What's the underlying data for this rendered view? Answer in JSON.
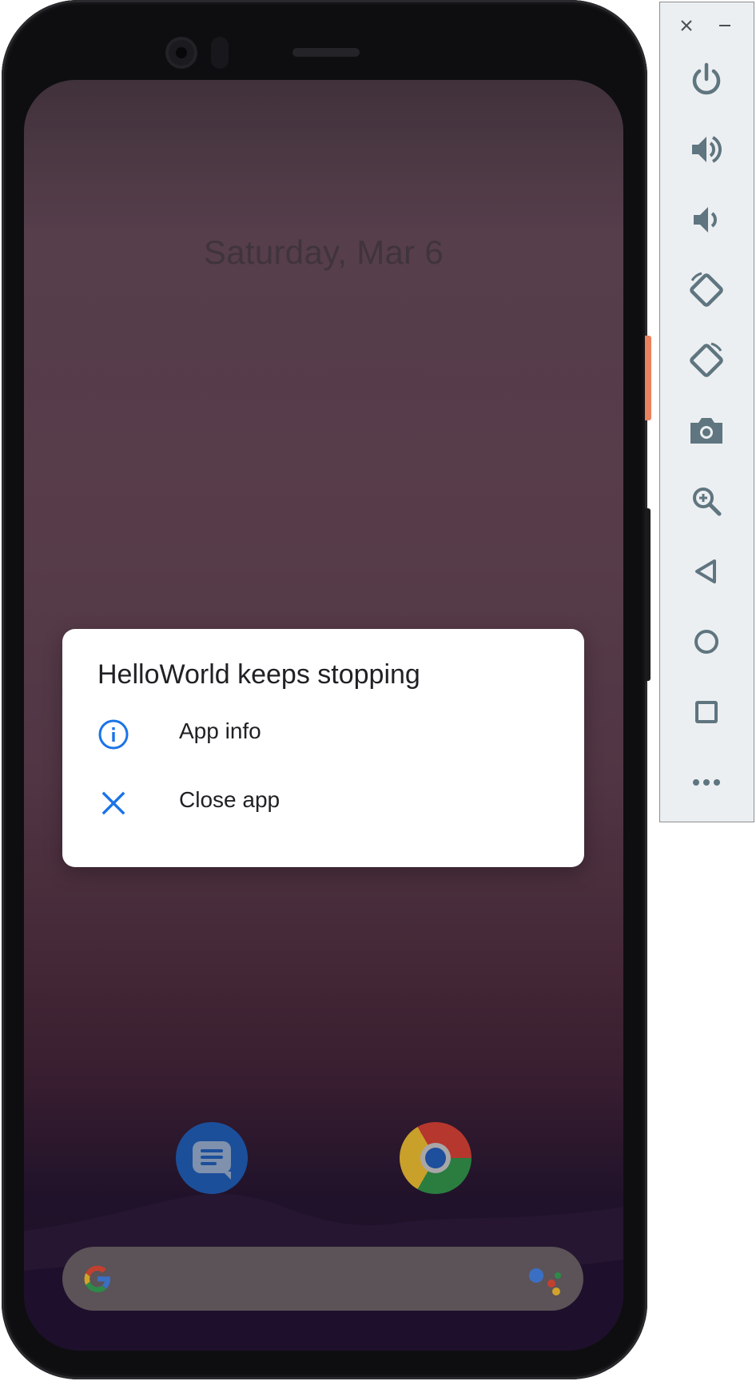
{
  "lockscreen": {
    "date": "Saturday, Mar 6"
  },
  "dialog": {
    "title": "HelloWorld keeps stopping",
    "items": [
      {
        "label": "App info",
        "icon": "info-icon"
      },
      {
        "label": "Close app",
        "icon": "close-icon"
      }
    ],
    "accent_color": "#1a73e8"
  },
  "dock": {
    "apps": [
      {
        "name": "messages-app",
        "icon": "messages-icon"
      },
      {
        "name": "chrome-app",
        "icon": "chrome-icon"
      }
    ]
  },
  "search_bar": {
    "logo": "google-g-icon",
    "assistant": "google-assistant-icon"
  },
  "emulator_toolbar": {
    "window_controls": [
      "close-icon",
      "minimize-icon"
    ],
    "buttons": [
      "power-icon",
      "volume-up-icon",
      "volume-down-icon",
      "rotate-left-icon",
      "rotate-right-icon",
      "camera-icon",
      "zoom-icon",
      "back-icon",
      "home-icon",
      "overview-icon",
      "more-icon"
    ],
    "icon_color": "#5f7580"
  }
}
